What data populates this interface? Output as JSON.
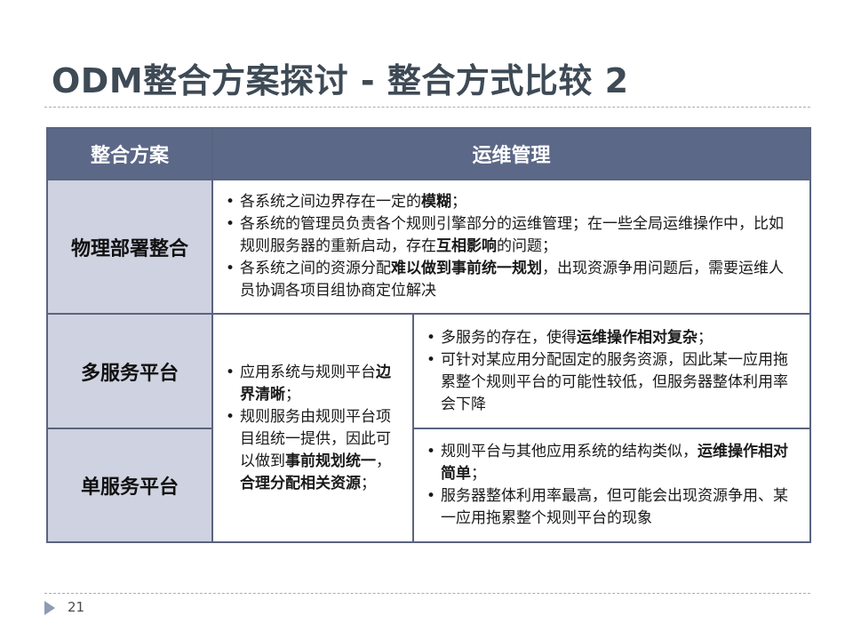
{
  "slide": {
    "title": "ODM整合方案探讨 - 整合方式比较 2",
    "page_number": "21"
  },
  "table": {
    "headers": [
      "整合方案",
      "运维管理"
    ],
    "rows": [
      {
        "label": "物理部署整合",
        "bullets": [
          [
            {
              "t": "各系统之间边界存在一定的"
            },
            {
              "t": "模糊",
              "b": true
            },
            {
              "t": "；"
            }
          ],
          [
            {
              "t": "各系统的管理员负责各个规则引擎部分的运维管理；在一些全局运维操作中，比如规则服务器的重新启动，存在"
            },
            {
              "t": "互相影响",
              "b": true
            },
            {
              "t": "的问题；"
            }
          ],
          [
            {
              "t": "各系统之间的资源分配"
            },
            {
              "t": "难以做到事前统一规划",
              "b": true
            },
            {
              "t": "，出现资源争用问题后，需要运维人员协调各项目组协商定位解决"
            }
          ]
        ]
      },
      {
        "label": "多服务平台",
        "bullets": [
          [
            {
              "t": "多服务的存在，使得"
            },
            {
              "t": "运维操作相对复杂",
              "b": true
            },
            {
              "t": "；"
            }
          ],
          [
            {
              "t": "可针对某应用分配固定的服务资源，因此某一应用拖累整个规则平台的可能性较低，但服务器整体利用率会下降"
            }
          ]
        ]
      },
      {
        "label": "单服务平台",
        "bullets": [
          [
            {
              "t": "规则平台与其他应用系统的结构类似，"
            },
            {
              "t": "运维操作相对简单",
              "b": true
            },
            {
              "t": "；"
            }
          ],
          [
            {
              "t": "服务器整体利用率最高，但可能会出现资源争用、某一应用拖累整个规则平台的现象"
            }
          ]
        ]
      }
    ],
    "shared_cell": {
      "bullets": [
        [
          {
            "t": "应用系统与规则平台"
          },
          {
            "t": "边界清晰",
            "b": true
          },
          {
            "t": "；"
          }
        ],
        [
          {
            "t": "规则服务由规则平台项目组统一提供，因此可以做到"
          },
          {
            "t": "事前规划统一",
            "b": true
          },
          {
            "t": "，"
          },
          {
            "t": "合理分配相关资源",
            "b": true
          },
          {
            "t": "；"
          }
        ]
      ]
    }
  }
}
